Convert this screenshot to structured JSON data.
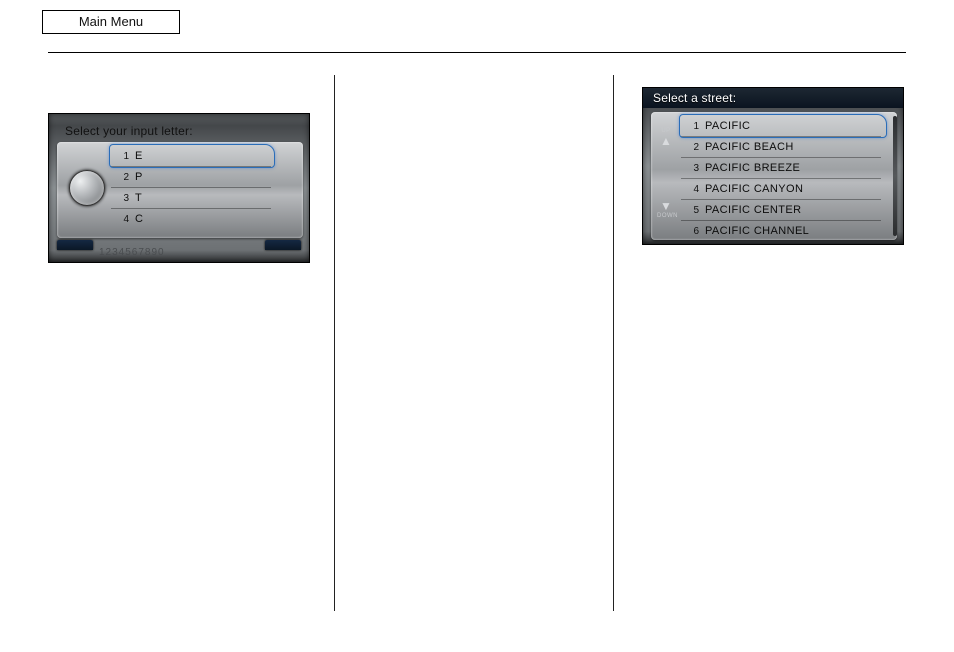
{
  "header": {
    "main_menu": "Main Menu"
  },
  "col_left": {
    "p1": "",
    "p2": "",
    "p3": ""
  },
  "col_mid": {
    "p1": "",
    "p2": "",
    "p3": "",
    "p4": ""
  },
  "col_right": {
    "p1": "",
    "p2": "",
    "p3": ""
  },
  "screenshot_left": {
    "title": "Select your input letter:",
    "rows": [
      {
        "n": "1",
        "v": "E"
      },
      {
        "n": "2",
        "v": "P"
      },
      {
        "n": "3",
        "v": "T"
      },
      {
        "n": "4",
        "v": "C"
      }
    ],
    "kbhint": "1234567890"
  },
  "screenshot_right": {
    "title": "Select a street:",
    "scroll_up": "UP",
    "scroll_down": "DOWN",
    "rows": [
      {
        "n": "1",
        "v": "PACIFIC"
      },
      {
        "n": "2",
        "v": "PACIFIC BEACH"
      },
      {
        "n": "3",
        "v": "PACIFIC BREEZE"
      },
      {
        "n": "4",
        "v": "PACIFIC CANYON"
      },
      {
        "n": "5",
        "v": "PACIFIC CENTER"
      },
      {
        "n": "6",
        "v": "PACIFIC CHANNEL"
      }
    ]
  }
}
